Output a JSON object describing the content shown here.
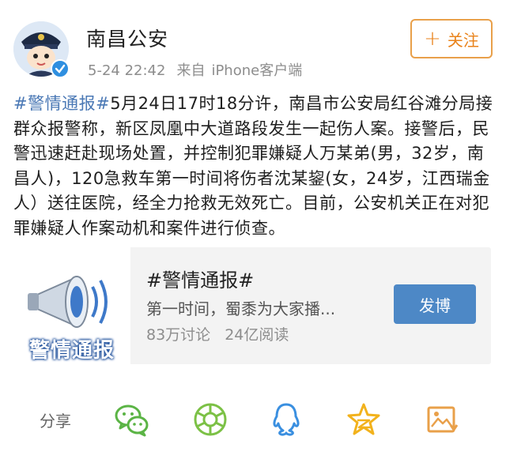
{
  "header": {
    "username": "南昌公安",
    "time": "5-24 22:42",
    "via_label": "来自",
    "client": "iPhone客户端",
    "follow_label": "关注",
    "avatar_icon": "police-cartoon-avatar",
    "verified_icon": "verified-badge-icon"
  },
  "post": {
    "hashtag": "#警情通报#",
    "body": "5月24日17时18分许，南昌市公安局红谷滩分局接群众报警称，新区凤凰中大道路段发生一起伤人案。接警后，民警迅速赶赴现场处置，并控制犯罪嫌疑人万某弟(男，32岁，南昌人)，120急救车第一时间将伤者沈某鋆(女，24岁，江西瑞金人）送往医院，经全力抢救无效死亡。目前，公安机关正在对犯罪嫌疑人作案动机和案件进行侦查。"
  },
  "topic_card": {
    "image_text": "警情通报",
    "title": "#警情通报#",
    "description": "第一时间，蜀黍为大家播...",
    "discussions": "83万讨论",
    "reads": "24亿阅读",
    "post_button": "发博"
  },
  "share": {
    "label": "分享",
    "icons": [
      "wechat-icon",
      "moments-icon",
      "qq-icon",
      "qzone-icon",
      "save-image-icon"
    ]
  },
  "colors": {
    "accent_orange": "#e9821a",
    "link_blue": "#4a78b5",
    "button_blue": "#4d88c6",
    "share_green": "#5bb445",
    "share_blue": "#3a8fe0",
    "share_yellow": "#f2b21c"
  }
}
